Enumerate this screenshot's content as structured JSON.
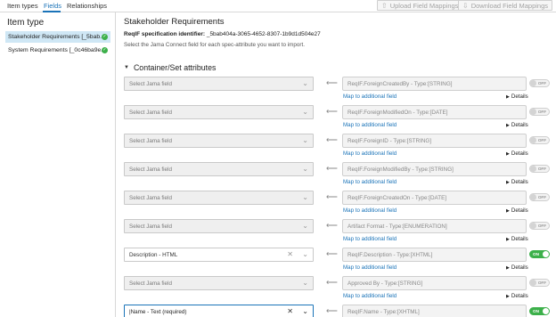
{
  "tabs": [
    {
      "label": "Item types"
    },
    {
      "label": "Fields"
    },
    {
      "label": "Relationships"
    }
  ],
  "toolbar": {
    "upload_label": "Upload Field Mappings",
    "download_label": "Download Field Mappings"
  },
  "item_type_panel": {
    "title": "Item type",
    "items": [
      {
        "label": "Stakeholder Requirements [_5bab...",
        "selected": true
      },
      {
        "label": "System Requirements [_0c46ba9e...",
        "selected": false
      }
    ]
  },
  "content": {
    "title": "Stakeholder Requirements",
    "identifier_label": "ReqIF specification identifier:",
    "identifier_value": "_5bab404a-3065-4652-8307-1b9d1d504e27",
    "description": "Select the Jama Connect field for each spec-attribute you want to import.",
    "section_title": "Container/Set attributes"
  },
  "common": {
    "map_link": "Map to additional field",
    "details": "Details",
    "off": "OFF",
    "on": "ON"
  },
  "mappings": [
    {
      "field": "Select Jama field",
      "reqif": "ReqIF.ForeignCreatedBy - Type:[STRING]",
      "enabled": false
    },
    {
      "field": "Select Jama field",
      "reqif": "ReqIF.ForeignModifiedOn - Type:[DATE]",
      "enabled": false
    },
    {
      "field": "Select Jama field",
      "reqif": "ReqIF.ForeignID - Type:[STRING]",
      "enabled": false
    },
    {
      "field": "Select Jama field",
      "reqif": "ReqIF.ForeignModifiedBy - Type:[STRING]",
      "enabled": false
    },
    {
      "field": "Select Jama field",
      "reqif": "ReqIF.ForeignCreatedOn - Type:[DATE]",
      "enabled": false
    },
    {
      "field": "Select Jama field",
      "reqif": "Artifact Format - Type:[ENUMERATION]",
      "enabled": false
    },
    {
      "field": "Description - HTML",
      "reqif": "ReqIF.Description - Type:[XHTML]",
      "enabled": true
    },
    {
      "field": "Select Jama field",
      "reqif": "Approved By - Type:[STRING]",
      "enabled": false
    },
    {
      "field": "|Name - Text (required)",
      "reqif": "ReqIF.Name - Type:[XHTML]",
      "enabled": true
    }
  ],
  "colors": {
    "accent": "#1a73b8",
    "toggle_on": "#3cb04a",
    "selected_bg": "#cfe7f5"
  }
}
